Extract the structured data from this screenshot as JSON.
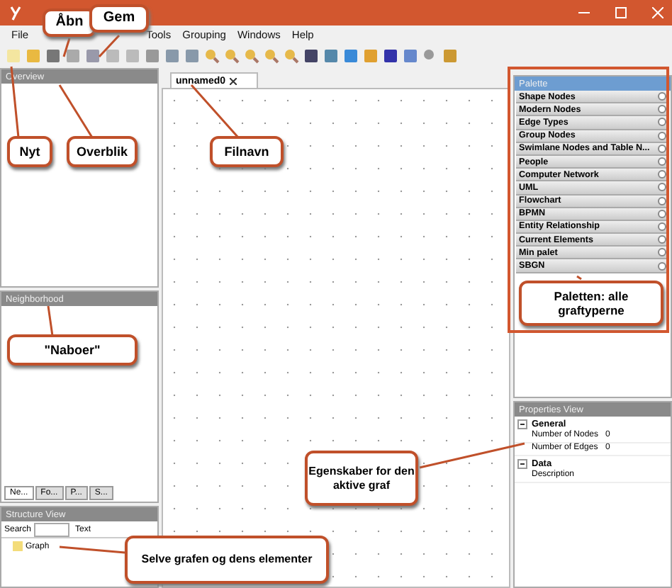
{
  "menu": [
    "File",
    "Tools",
    "Grouping",
    "Windows",
    "Help"
  ],
  "overview": {
    "title": "Overview"
  },
  "neighborhood": {
    "title": "Neighborhood"
  },
  "dock_tabs": [
    {
      "label": "Ne...",
      "selected": true
    },
    {
      "label": "Fo...",
      "selected": false
    },
    {
      "label": "P...",
      "selected": false
    },
    {
      "label": "S...",
      "selected": false
    }
  ],
  "structure": {
    "title": "Structure View",
    "search_label": "Search",
    "search_mode": "Text",
    "tree": [
      {
        "label": "Graph"
      }
    ]
  },
  "editor_tab": {
    "label": "unnamed0"
  },
  "palette": {
    "title": "Palette",
    "sections": [
      {
        "label": "Shape Nodes",
        "expanded": false
      },
      {
        "label": "Modern Nodes",
        "expanded": false
      },
      {
        "label": "Edge Types",
        "expanded": false
      },
      {
        "label": "Group Nodes",
        "expanded": false
      },
      {
        "label": "Swimlane Nodes and Table N...",
        "expanded": false
      },
      {
        "label": "People",
        "expanded": false
      },
      {
        "label": "Computer Network",
        "expanded": false
      },
      {
        "label": "UML",
        "expanded": false
      },
      {
        "label": "Flowchart",
        "expanded": false
      },
      {
        "label": "BPMN",
        "expanded": false
      },
      {
        "label": "Entity Relationship",
        "expanded": false
      },
      {
        "label": "Current Elements",
        "expanded": false
      },
      {
        "label": "Min palet",
        "expanded": false
      },
      {
        "label": "SBGN",
        "expanded": false
      }
    ]
  },
  "properties": {
    "title": "Properties View",
    "groups": [
      {
        "label": "General",
        "expanded": true,
        "rows": [
          {
            "name": "Number of Nodes",
            "value": "0"
          },
          {
            "name": "Number of Edges",
            "value": "0"
          }
        ]
      },
      {
        "label": "Data",
        "expanded": true,
        "rows": [
          {
            "name": "Description",
            "value": ""
          }
        ]
      }
    ]
  },
  "callouts": [
    {
      "text": "Åbn"
    },
    {
      "text": "Gem"
    },
    {
      "text": "Nyt"
    },
    {
      "text": "Overblik"
    },
    {
      "text": "Filnavn"
    },
    {
      "text": "\"Naboer\""
    },
    {
      "text": "Paletten: alle graftyperne"
    },
    {
      "text": "Egenskaber for den aktive graf"
    },
    {
      "text": "Selve grafen og dens elementer"
    }
  ]
}
